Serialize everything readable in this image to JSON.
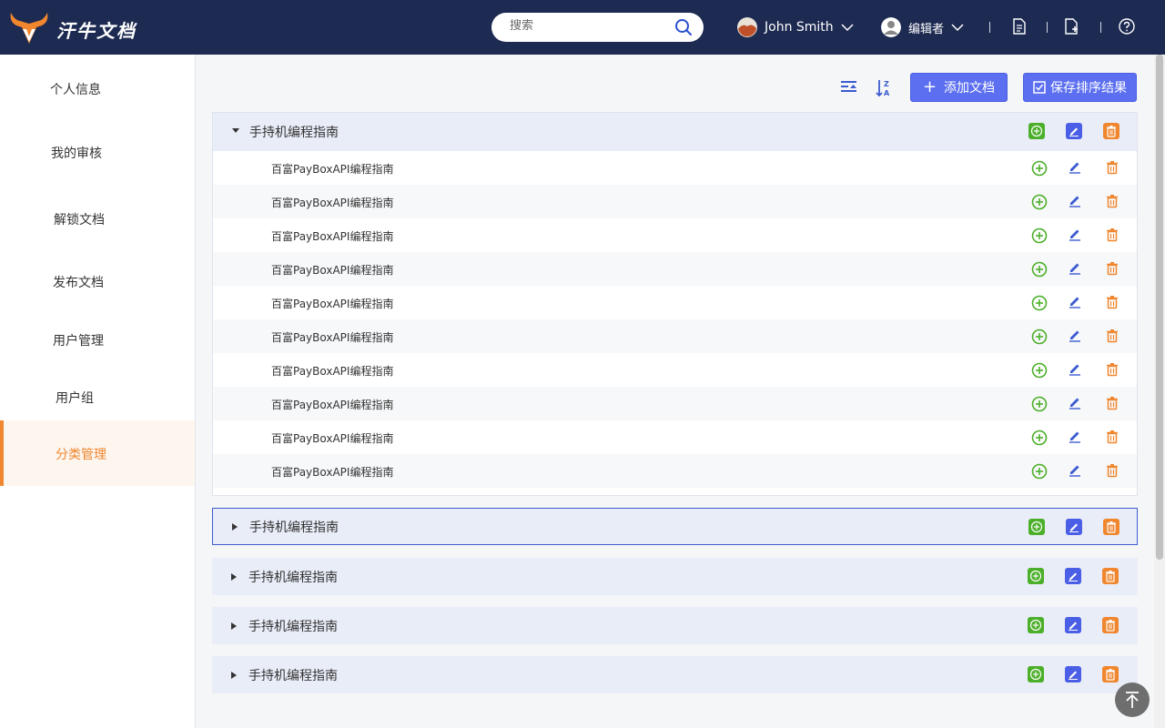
{
  "app": {
    "title": "汗牛文档"
  },
  "header": {
    "search_placeholder": "搜索",
    "user_name": "John Smith",
    "role": "编辑者"
  },
  "sidebar": {
    "items": [
      {
        "label": "个人信息"
      },
      {
        "label": "我的审核"
      },
      {
        "label": "解锁文档"
      },
      {
        "label": "发布文档"
      },
      {
        "label": "用户管理"
      },
      {
        "label": "用户组"
      },
      {
        "label": "分类管理",
        "active": true
      }
    ]
  },
  "toolbar": {
    "add_doc_label": "添加文档",
    "save_sort_label": "保存排序结果"
  },
  "groups": [
    {
      "title": "手持机编程指南",
      "expanded": true,
      "items": [
        "百富PayBoxAPI编程指南",
        "百富PayBoxAPI编程指南",
        "百富PayBoxAPI编程指南",
        "百富PayBoxAPI编程指南",
        "百富PayBoxAPI编程指南",
        "百富PayBoxAPI编程指南",
        "百富PayBoxAPI编程指南",
        "百富PayBoxAPI编程指南",
        "百富PayBoxAPI编程指南",
        "百富PayBoxAPI编程指南"
      ]
    },
    {
      "title": "手持机编程指南",
      "expanded": false,
      "selected": true
    },
    {
      "title": "手持机编程指南",
      "expanded": false
    },
    {
      "title": "手持机编程指南",
      "expanded": false
    },
    {
      "title": "手持机编程指南",
      "expanded": false
    }
  ],
  "colors": {
    "header_bg": "#1d2b52",
    "accent_orange": "#f0862e",
    "primary_blue": "#5b6ff0",
    "green": "#4caf2a"
  },
  "icons": {
    "search": "search-icon",
    "add": "add-circle-icon",
    "edit": "edit-icon",
    "delete": "trash-icon",
    "collapse_all": "collapse-all-icon",
    "sort": "sort-az-icon",
    "back_to_top": "back-to-top-icon"
  }
}
